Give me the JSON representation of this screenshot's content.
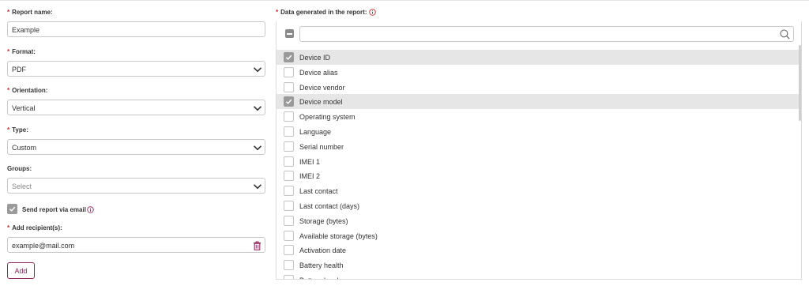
{
  "form": {
    "report_name": {
      "label": "Report name:",
      "value": "Example"
    },
    "format": {
      "label": "Format:",
      "value": "PDF"
    },
    "orientation": {
      "label": "Orientation:",
      "value": "Vertical"
    },
    "type": {
      "label": "Type:",
      "value": "Custom"
    },
    "groups": {
      "label": "Groups:",
      "placeholder": "Select"
    },
    "send_email": {
      "label": "Send report via email",
      "checked": true
    },
    "recipients": {
      "label": "Add recipient(s):",
      "value": "example@mail.com"
    },
    "add_button": "Add",
    "required_mark": "*"
  },
  "data_panel": {
    "label": "Data generated in the report:",
    "search_value": "",
    "items": [
      {
        "label": "Device ID",
        "checked": true
      },
      {
        "label": "Device alias",
        "checked": false
      },
      {
        "label": "Device vendor",
        "checked": false
      },
      {
        "label": "Device model",
        "checked": true
      },
      {
        "label": "Operating system",
        "checked": false
      },
      {
        "label": "Language",
        "checked": false
      },
      {
        "label": "Serial number",
        "checked": false
      },
      {
        "label": "IMEI 1",
        "checked": false
      },
      {
        "label": "IMEI 2",
        "checked": false
      },
      {
        "label": "Last contact",
        "checked": false
      },
      {
        "label": "Last contact (days)",
        "checked": false
      },
      {
        "label": "Storage (bytes)",
        "checked": false
      },
      {
        "label": "Available storage (bytes)",
        "checked": false
      },
      {
        "label": "Activation date",
        "checked": false
      },
      {
        "label": "Battery health",
        "checked": false
      },
      {
        "label": "Battery level",
        "checked": false
      }
    ]
  },
  "colors": {
    "required": "#d9282f",
    "accent": "#8e2a5a",
    "checked_box": "#9a9a9a",
    "selected_row": "#e6e6e6"
  }
}
